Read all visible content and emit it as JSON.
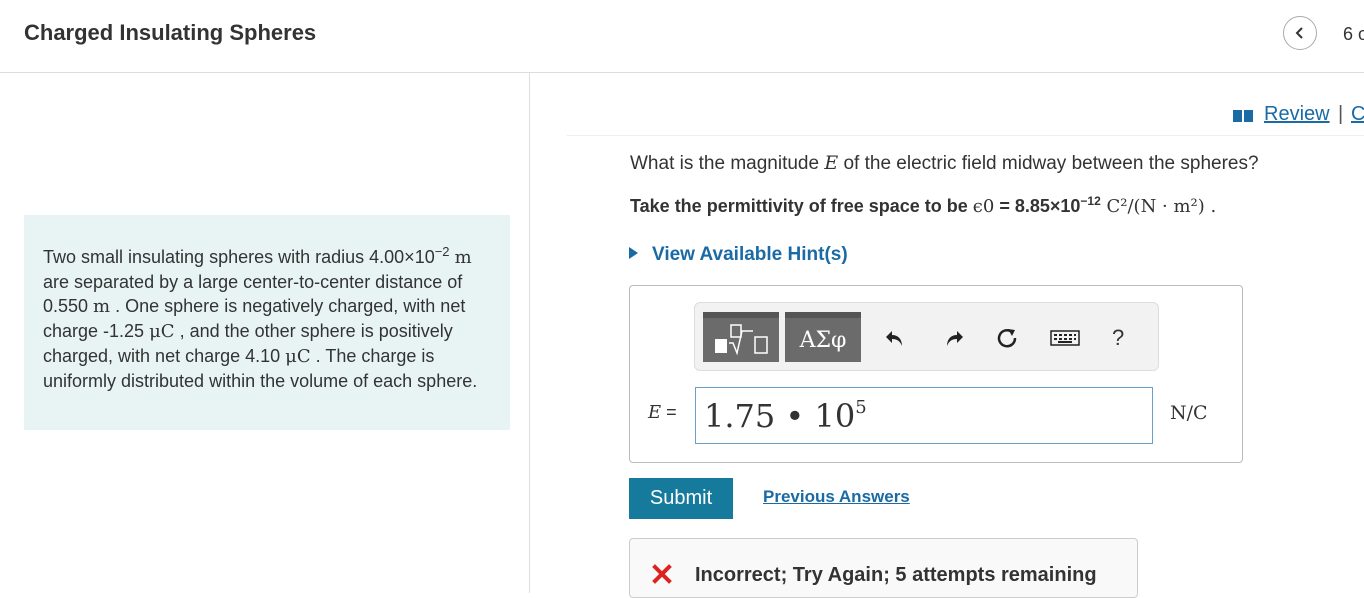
{
  "header": {
    "title": "Charged Insulating Spheres",
    "page_count": "6 o"
  },
  "problem": {
    "t1": "Two small insulating spheres with radius 4.00×10",
    "t1_exp": "−2",
    "m1": "m",
    "t2": " are separated by a large center-to-center distance of 0.550 ",
    "m2": "m",
    "t3": " . One sphere is negatively charged, with net charge -1.25 ",
    "m3": "μC",
    "t4": " , and the other sphere is positively charged, with net charge 4.10 ",
    "m4": "μC",
    "t5": " . The charge is uniformly distributed within the volume of each sphere."
  },
  "links": {
    "review": "Review",
    "separator": "|",
    "constants": "C"
  },
  "question": {
    "q1": "What is the magnitude ",
    "q_var": "E",
    "q2": " of the electric field midway between the spheres?",
    "p1": "Take the permittivity of free space to be ",
    "p_eps": "ϵ0",
    "p2": " = 8.85×10",
    "p_exp": "−12",
    "p_unit": " C²/(N · m²) ."
  },
  "hint": {
    "label": "View Available Hint(s)"
  },
  "toolbar": {
    "greek_label": "ΑΣφ",
    "help_label": "?"
  },
  "answer": {
    "var_label": "E",
    "equals": " =",
    "value_base": "1.75 • 10",
    "value_exp": "5",
    "unit": "N/C"
  },
  "actions": {
    "submit": "Submit",
    "previous_answers": "Previous Answers"
  },
  "feedback": {
    "message": "Incorrect; Try Again; 5 attempts remaining",
    "color": "#d22"
  },
  "colors": {
    "accent": "#167a9c",
    "link": "#1a6aa5",
    "problem_bg": "#e8f4f4"
  }
}
